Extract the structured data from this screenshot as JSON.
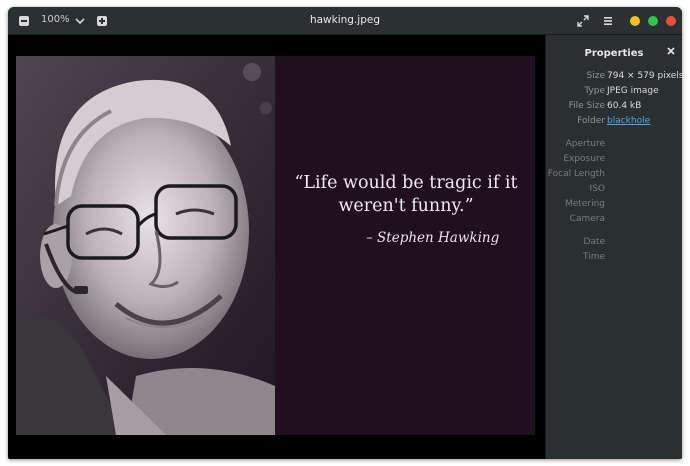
{
  "app": {
    "title": "hawking.jpeg",
    "zoom_level": "100%"
  },
  "photo": {
    "quote_line1": "“Life would be tragic if it",
    "quote_line2": "weren't funny.”",
    "attribution": "– Stephen Hawking"
  },
  "properties": {
    "title": "Properties",
    "rows": [
      {
        "label": "Size",
        "value": "794 × 579 pixels"
      },
      {
        "label": "Type",
        "value": "JPEG image"
      },
      {
        "label": "File Size",
        "value": "60.4 kB"
      },
      {
        "label": "Folder",
        "value": "blackhole"
      }
    ],
    "exif_rows": [
      {
        "label": "Aperture",
        "value": ""
      },
      {
        "label": "Exposure",
        "value": ""
      },
      {
        "label": "Focal Length",
        "value": ""
      },
      {
        "label": "ISO",
        "value": ""
      },
      {
        "label": "Metering",
        "value": ""
      },
      {
        "label": "Camera",
        "value": ""
      }
    ],
    "date_rows": [
      {
        "label": "Date",
        "value": ""
      },
      {
        "label": "Time",
        "value": ""
      }
    ]
  },
  "colors": {
    "accent_link": "#4aa9e6",
    "close": "#f24c36",
    "minimize": "#f4c21b",
    "maximize": "#33c548"
  }
}
